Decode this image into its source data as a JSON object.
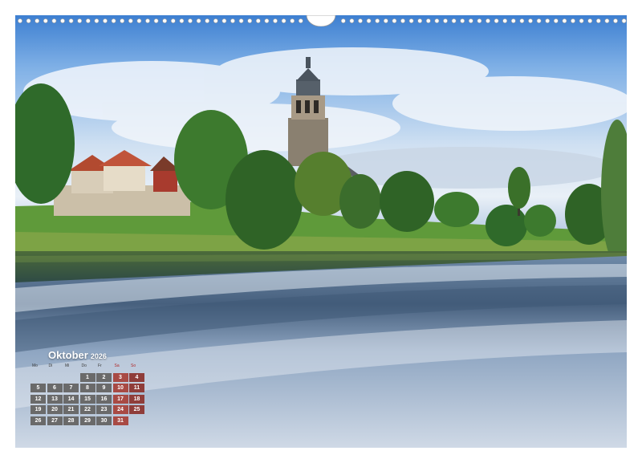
{
  "calendar": {
    "month": "Oktober",
    "year": "2026",
    "weekdays": [
      "Mo",
      "Di",
      "Mi",
      "Do",
      "Fr",
      "Sa",
      "So"
    ],
    "weeks": [
      [
        "",
        "",
        "",
        "1",
        "2",
        "3",
        "4"
      ],
      [
        "5",
        "6",
        "7",
        "8",
        "9",
        "10",
        "11"
      ],
      [
        "12",
        "13",
        "14",
        "15",
        "16",
        "17",
        "18"
      ],
      [
        "19",
        "20",
        "21",
        "22",
        "23",
        "24",
        "25"
      ],
      [
        "26",
        "27",
        "28",
        "29",
        "30",
        "31",
        ""
      ]
    ]
  },
  "colors": {
    "sky": "#7fb0e6",
    "foliage": "#3f7a2e",
    "river": "#5f7f9f",
    "weekday_cell": "#6a6a6a",
    "weekend_cell": "#a84a44"
  }
}
